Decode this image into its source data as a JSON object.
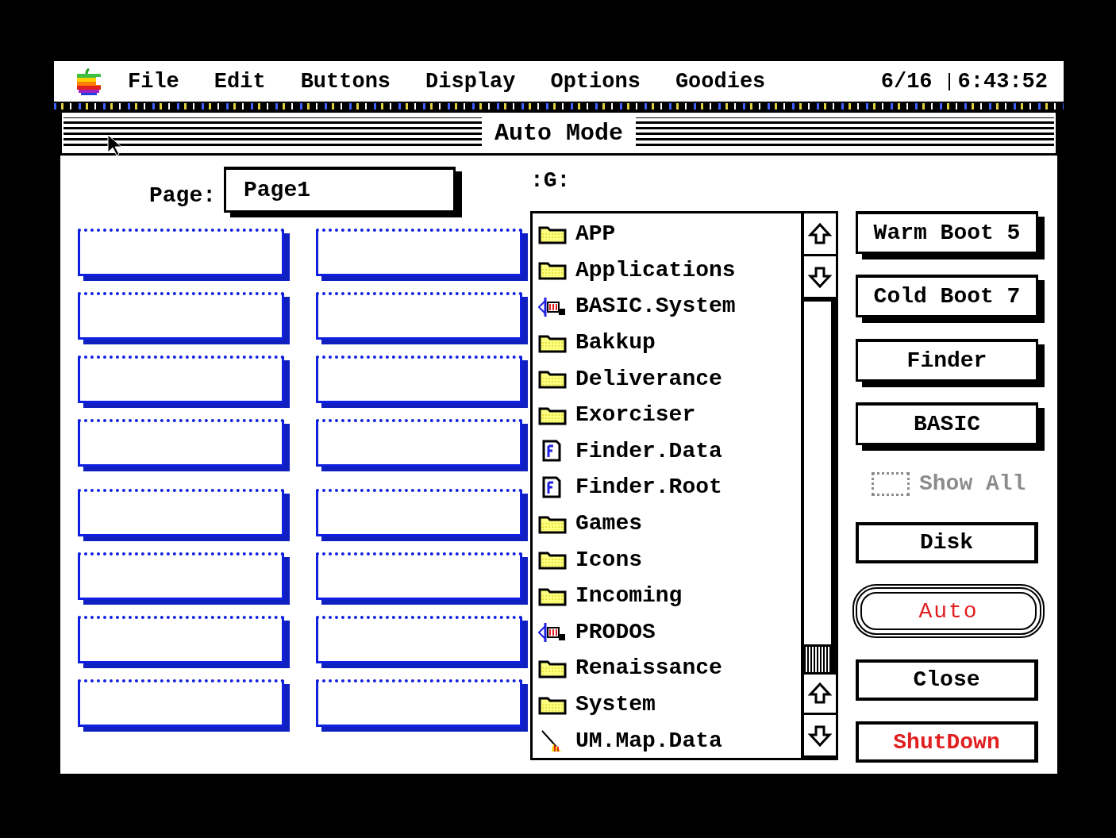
{
  "menu_bar": {
    "items": [
      "File",
      "Edit",
      "Buttons",
      "Display",
      "Options",
      "Goodies"
    ],
    "date": "6/16",
    "time": "6:43:52"
  },
  "window": {
    "title": "Auto Mode"
  },
  "page": {
    "label": "Page:",
    "value": "Page1"
  },
  "slot_groups": [
    {
      "slots": [
        {
          "kind": "empty"
        },
        {
          "kind": "empty"
        },
        {
          "kind": "empty"
        },
        {
          "kind": "empty"
        },
        {
          "kind": "empty"
        },
        {
          "kind": "empty"
        },
        {
          "kind": "empty"
        },
        {
          "kind": "empty"
        }
      ]
    },
    {
      "slots": [
        {
          "kind": "empty"
        },
        {
          "kind": "empty"
        },
        {
          "kind": "empty"
        },
        {
          "kind": "empty"
        },
        {
          "kind": "empty"
        },
        {
          "kind": "empty"
        },
        {
          "kind": "empty"
        },
        {
          "kind": "empty"
        }
      ]
    }
  ],
  "file_list": {
    "path": ":G:",
    "items": [
      {
        "name": "APP",
        "kind": "folder"
      },
      {
        "name": "Applications",
        "kind": "folder"
      },
      {
        "name": "BASIC.System",
        "kind": "system"
      },
      {
        "name": "Bakkup",
        "kind": "folder"
      },
      {
        "name": "Deliverance",
        "kind": "folder"
      },
      {
        "name": "Exorciser",
        "kind": "folder"
      },
      {
        "name": "Finder.Data",
        "kind": "finder"
      },
      {
        "name": "Finder.Root",
        "kind": "finder"
      },
      {
        "name": "Games",
        "kind": "folder"
      },
      {
        "name": "Icons",
        "kind": "folder"
      },
      {
        "name": "Incoming",
        "kind": "folder"
      },
      {
        "name": "PRODOS",
        "kind": "system"
      },
      {
        "name": "Renaissance",
        "kind": "folder"
      },
      {
        "name": "System",
        "kind": "folder"
      },
      {
        "name": "UM.Map.Data",
        "kind": "data"
      }
    ]
  },
  "buttons": [
    {
      "label": "Warm Boot 5",
      "kind": "shadow",
      "disabled": false
    },
    {
      "label": "Cold Boot 7",
      "kind": "shadow",
      "disabled": false
    },
    {
      "label": "Finder",
      "kind": "shadow",
      "disabled": false
    },
    {
      "label": "BASIC",
      "kind": "shadow",
      "disabled": false
    },
    {
      "label": "Show All",
      "kind": "checkbox",
      "disabled": true
    },
    {
      "label": "Disk",
      "kind": "plain",
      "disabled": false
    },
    {
      "label": "Auto",
      "kind": "default",
      "disabled": true,
      "color": "#e02020"
    },
    {
      "label": "Close",
      "kind": "plain",
      "disabled": false
    },
    {
      "label": "ShutDown",
      "kind": "plain",
      "disabled": false,
      "color": "#e02020"
    }
  ]
}
